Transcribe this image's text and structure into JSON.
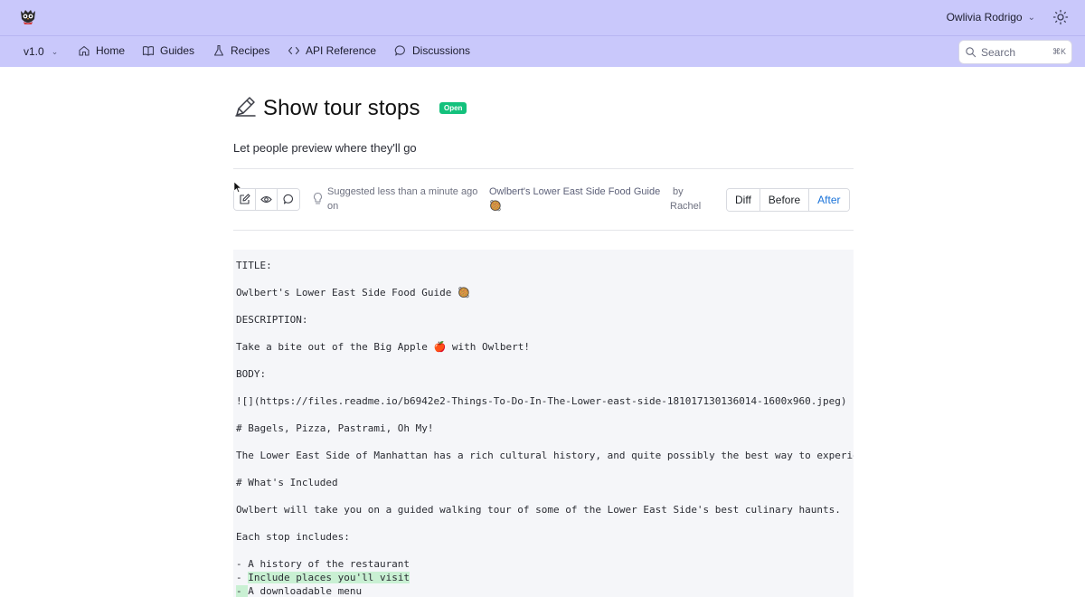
{
  "header": {
    "user_name": "Owlivia Rodrigo",
    "user_chevron": "chevron-down-icon",
    "theme_icon": "sun-icon",
    "bar_color": "#c9c8fb"
  },
  "nav": {
    "version": "v1.0",
    "items": [
      {
        "label": "Home",
        "icon": "home-icon"
      },
      {
        "label": "Guides",
        "icon": "book-icon"
      },
      {
        "label": "Recipes",
        "icon": "flask-icon"
      },
      {
        "label": "API Reference",
        "icon": "code-icon"
      },
      {
        "label": "Discussions",
        "icon": "chat-bubble-icon"
      }
    ],
    "search_placeholder": "Search",
    "search_shortcut": "⌘K"
  },
  "page": {
    "title": "Show tour stops",
    "status": "Open",
    "status_color": "#13c17c",
    "subtitle": "Let people preview where they'll go"
  },
  "suggestion": {
    "text_line1": "Suggested less than a minute ago",
    "text_line2": "on",
    "doc_link": "Owlbert's Lower East Side Food Guide",
    "doc_emoji": "🥘",
    "by": "by",
    "author": "Rachel"
  },
  "view_toggle": {
    "options": [
      "Diff",
      "Before",
      "After"
    ],
    "active": "After",
    "active_color": "#1a73d9"
  },
  "content_lines": [
    "TITLE:",
    "Owlbert's Lower East Side Food Guide 🥘",
    "DESCRIPTION:",
    "Take a bite out of the Big Apple 🍎 with Owlbert!",
    "BODY:",
    "![](https://files.readme.io/b6942e2-Things-To-Do-In-The-Lower-east-side-181017130136014-1600x960.jpeg)",
    "# Bagels, Pizza, Pastrami, Oh My!",
    "The Lower East Side of Manhattan has a rich cultural history, and quite possibly the best way to experien",
    "# What's Included",
    "Owlbert will take you on a guided walking tour of some of the Lower East Side's best culinary haunts.",
    "Each stop includes:",
    "- A history of the restaurant",
    "Include places you'll visit",
    "A downloadable menu"
  ],
  "diff_prefix_plain": "- ",
  "diff_prefix_marked": "- "
}
